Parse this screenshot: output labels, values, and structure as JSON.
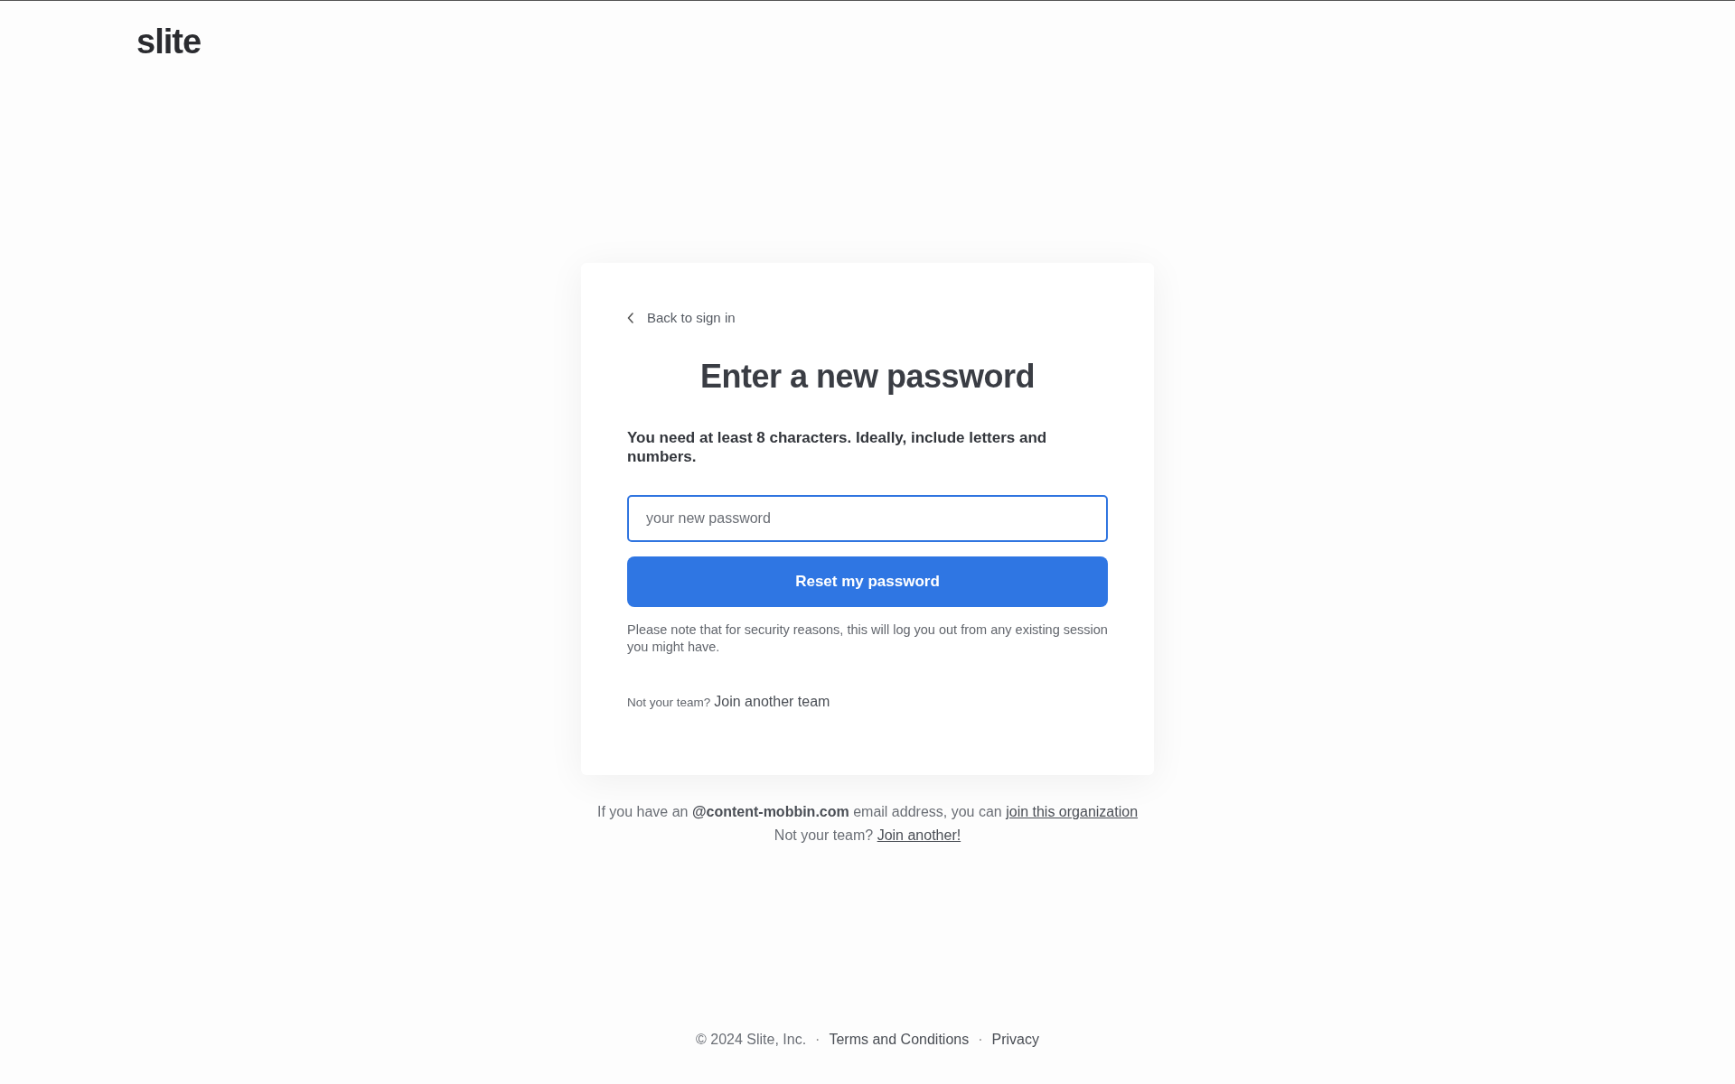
{
  "logo": "slite",
  "card": {
    "back_link": "Back to sign in",
    "title": "Enter a new password",
    "instructions": "You need at least 8 characters. Ideally, include letters and numbers.",
    "password_field": {
      "placeholder": "your new password",
      "focused": true
    },
    "submit_button": "Reset my password",
    "note": "Please note that for security reasons, this will log you out from any existing session you might have.",
    "team_prompt": "Not your team?",
    "team_link": "Join another team"
  },
  "org_notice": {
    "text": "If you have an **@content-mobbin.com** email address, you can",
    "link": "join this organization"
  },
  "join_prompt": {
    "text": "Not your team?",
    "link": "Join another!"
  },
  "footer": [
    {
      "kind": "text",
      "text": "© 2024 Slite, Inc."
    },
    {
      "kind": "separator",
      "text": "·"
    },
    {
      "kind": "link",
      "text": "Terms and Conditions"
    },
    {
      "kind": "separator",
      "text": "·"
    },
    {
      "kind": "link",
      "text": "Privacy"
    }
  ]
}
